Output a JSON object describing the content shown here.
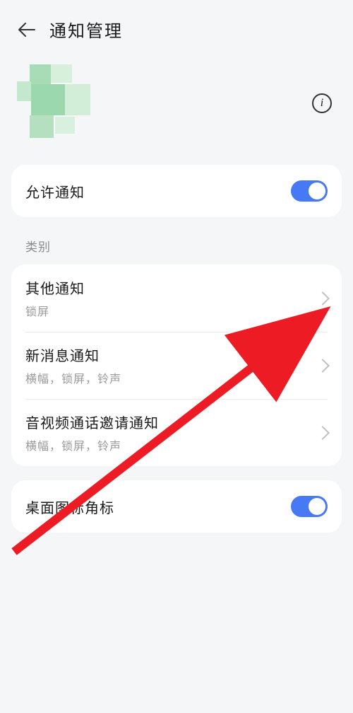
{
  "header": {
    "title": "通知管理"
  },
  "allow_notifications": {
    "label": "允许通知",
    "enabled": true
  },
  "category_section": {
    "title": "类别",
    "items": [
      {
        "title": "其他通知",
        "sub": "锁屏"
      },
      {
        "title": "新消息通知",
        "sub": "横幅，锁屏，铃声"
      },
      {
        "title": "音视频通话邀请通知",
        "sub": "横幅，锁屏，铃声"
      }
    ]
  },
  "desktop_badge": {
    "label": "桌面图标角标",
    "enabled": true
  },
  "colors": {
    "accent": "#4879f5",
    "background": "#f5f6f8",
    "arrow": "#ed1c24"
  }
}
